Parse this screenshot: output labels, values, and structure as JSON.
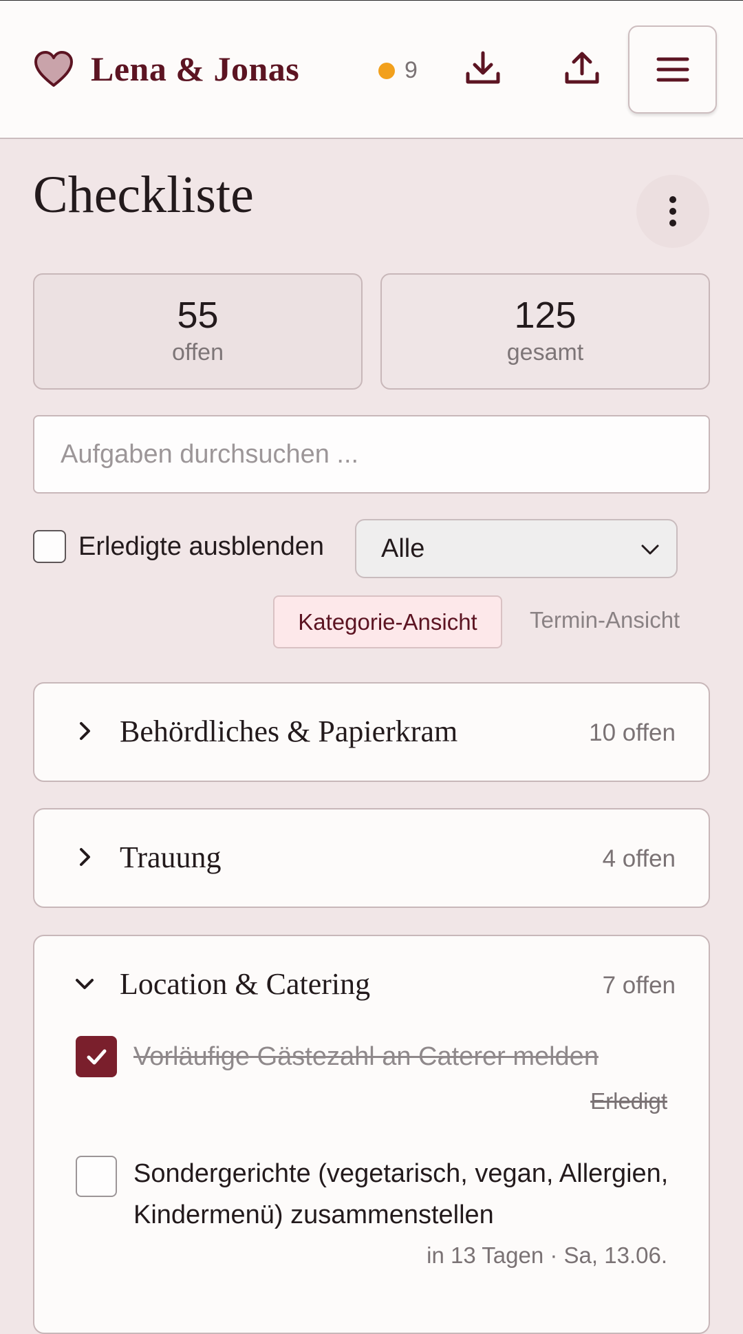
{
  "header": {
    "brand_name": "Lena & Jonas",
    "notification_count": "9",
    "colors": {
      "brand": "#5c1422",
      "notification_dot": "#f2a01c"
    },
    "icons": [
      "heart-icon",
      "download-icon",
      "upload-icon",
      "hamburger-menu-icon"
    ]
  },
  "page": {
    "title": "Checkliste",
    "more_icon": "vertical-dots-icon"
  },
  "stats": {
    "open": {
      "value": "55",
      "label": "offen"
    },
    "total": {
      "value": "125",
      "label": "gesamt"
    }
  },
  "search": {
    "placeholder": "Aufgaben durchsuchen ..."
  },
  "filters": {
    "hide_done_label": "Erledigte ausblenden",
    "hide_done_checked": false,
    "select_value": "Alle"
  },
  "views": {
    "category": "Kategorie-Ansicht",
    "date": "Termin-Ansicht",
    "active": "category"
  },
  "categories": [
    {
      "title": "Behördliches & Papierkram",
      "count": "10 offen",
      "expanded": false
    },
    {
      "title": "Trauung",
      "count": "4 offen",
      "expanded": false
    },
    {
      "title": "Location & Catering",
      "count": "7 offen",
      "expanded": true,
      "tasks": [
        {
          "text": "Vorläufige Gästezahl an Caterer melden",
          "meta": "Erledigt",
          "done": true
        },
        {
          "text": "Sondergerichte (vegetarisch, vegan, Allergien, Kindermenü) zusammenstellen",
          "meta": "in 13 Tagen · Sa, 13.06.",
          "done": false
        }
      ]
    }
  ]
}
